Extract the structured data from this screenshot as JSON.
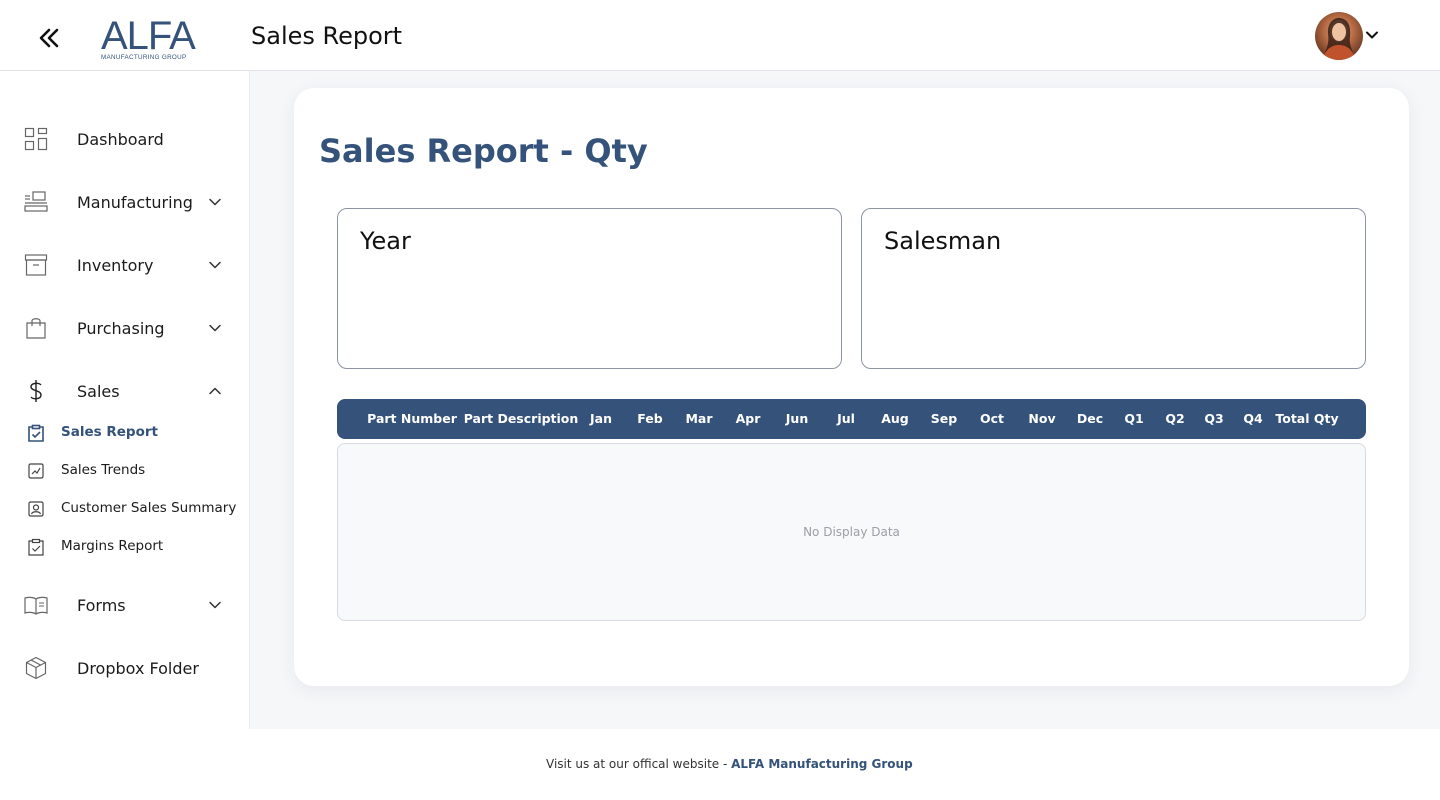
{
  "header": {
    "title": "Sales Report",
    "logo_text": "ALFA",
    "logo_subtext": "MANUFACTURING GROUP",
    "collapse_icon": "double-chevron-left-icon"
  },
  "sidebar": {
    "items": [
      {
        "label": "Dashboard",
        "icon": "dashboard-icon",
        "expandable": false
      },
      {
        "label": "Manufacturing",
        "icon": "manufacturing-icon",
        "expandable": true,
        "expanded": false
      },
      {
        "label": "Inventory",
        "icon": "archive-box-icon",
        "expandable": true,
        "expanded": false
      },
      {
        "label": "Purchasing",
        "icon": "shopping-bag-icon",
        "expandable": true,
        "expanded": false
      },
      {
        "label": "Sales",
        "icon": "dollar-icon",
        "expandable": true,
        "expanded": true
      },
      {
        "label": "Forms",
        "icon": "book-icon",
        "expandable": true,
        "expanded": false
      },
      {
        "label": "Dropbox Folder",
        "icon": "package-icon",
        "expandable": false
      }
    ],
    "sales_subitems": [
      {
        "label": "Sales Report",
        "icon": "clipboard-check-icon",
        "active": true
      },
      {
        "label": "Sales Trends",
        "icon": "trend-chart-icon",
        "active": false
      },
      {
        "label": "Customer Sales Summary",
        "icon": "user-card-icon",
        "active": false
      },
      {
        "label": "Margins Report",
        "icon": "clipboard-check-icon",
        "active": false
      }
    ]
  },
  "main": {
    "card_title": "Sales Report - Qty",
    "filters": {
      "year_label": "Year",
      "salesman_label": "Salesman"
    },
    "table": {
      "columns": [
        "Part Number",
        "Part Description",
        "Jan",
        "Feb",
        "Mar",
        "Apr",
        "Jun",
        "Jul",
        "Aug",
        "Sep",
        "Oct",
        "Nov",
        "Dec",
        "Q1",
        "Q2",
        "Q3",
        "Q4",
        "Total Qty"
      ],
      "rows": [],
      "empty_text": "No Display Data"
    }
  },
  "footer": {
    "text": "Visit us at our offical website - ",
    "link": "ALFA Manufacturing Group"
  },
  "colors": {
    "accent": "#34527a",
    "page_bg": "#f6f7f9"
  }
}
